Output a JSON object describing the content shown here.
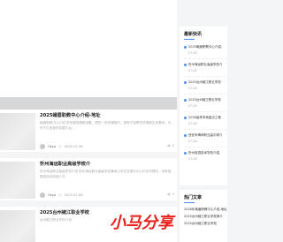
{
  "posts": [
    {
      "title": "2025峨眉职教中心介绍-地址",
      "excerpt": "峨眉职教中心介绍 学校重视课程设置，提供一系列课程内，具有丰富教学资源和实训基地，为学子打造良好发展平台。",
      "author": "Okya",
      "date": "2025-07-08",
      "views": "0"
    },
    {
      "title": "忻州海运职业高级学校介",
      "excerpt": "忻州海运职业高级学校介绍 忻州海运职业高级学校秉承以学生发展为中心的办学理念，培养高素质技术技能人才。",
      "author": "Okya",
      "date": "2025-07-08",
      "views": "0"
    },
    {
      "title": "2025台州椒江职业学校",
      "excerpt": "台州椒江职业学校介绍",
      "author": "Okya",
      "date": "2025-07-08",
      "views": "0"
    }
  ],
  "sidebar": {
    "latest_title": "最新快讯",
    "latest_items": [
      {
        "text": "2025峨眉职教中心介绍-",
        "date": "07-08"
      },
      {
        "text": "忻州海运职业高级学校介",
        "date": "07-08"
      },
      {
        "text": "2025台州椒江职业学校",
        "date": "07-08"
      },
      {
        "text": "2025台州椒江职业学校",
        "date": "07-08"
      },
      {
        "text": "2026高考本地重点工程",
        "date": "07-08"
      },
      {
        "text": "西安市碑林职业高中简介",
        "date": "07-08"
      },
      {
        "text": "忻州前进技术学校介绍-",
        "date": "07-08"
      }
    ],
    "hot_title": "热门文章",
    "hot_items": [
      "2026年峨眉职教中心介绍-地址",
      "2025台州椒江职业学校简介",
      "2025台州椒江职业学校"
    ]
  },
  "watermark": {
    "text": "小马分享"
  }
}
